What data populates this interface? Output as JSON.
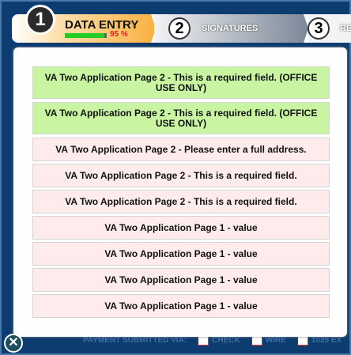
{
  "steps": [
    {
      "number": "1",
      "label": "DATA ENTRY",
      "progress_percent": 95,
      "progress_text": "95 %"
    },
    {
      "number": "2",
      "label": "SIGNATURES"
    },
    {
      "number": "3",
      "label": "RE"
    }
  ],
  "messages": [
    {
      "text": "VA Two Application Page 2 - This is a required field. (OFFICE USE ONLY)",
      "status": "green"
    },
    {
      "text": "VA Two Application Page 2 - This is a required field. (OFFICE USE ONLY)",
      "status": "green"
    },
    {
      "text": "VA Two Application Page 2 - Please enter a full address.",
      "status": "pink"
    },
    {
      "text": "VA Two Application Page 2 - This is a required field.",
      "status": "pink"
    },
    {
      "text": "VA Two Application Page 2 - This is a required field.",
      "status": "pink"
    },
    {
      "text": "VA Two Application Page 1 - value",
      "status": "pink"
    },
    {
      "text": "VA Two Application Page 1 - value",
      "status": "pink"
    },
    {
      "text": "VA Two Application Page 1 - value",
      "status": "pink"
    },
    {
      "text": "VA Two Application Page 1 - value",
      "status": "pink"
    }
  ],
  "footer": {
    "label": "PAYMENT SUBMITTED VIA:",
    "options": [
      "CHECK",
      "WIRE",
      "1035 EX"
    ]
  },
  "colors": {
    "green": "#c9f5a3",
    "pink": "#fdeceb",
    "background": "#0d3c70"
  }
}
